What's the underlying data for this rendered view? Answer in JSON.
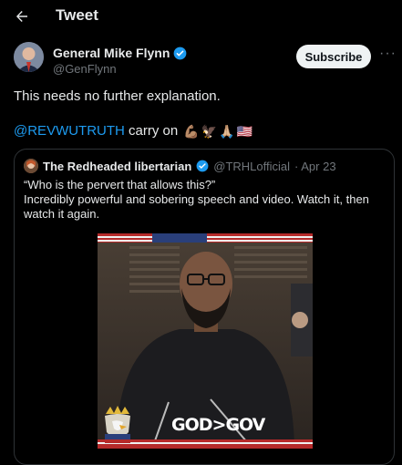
{
  "header": {
    "title": "Tweet",
    "back_icon": "arrow-left-icon"
  },
  "author": {
    "name": "General Mike Flynn",
    "handle": "@GenFlynn",
    "verified": true,
    "subscribe_label": "Subscribe",
    "more_label": "···"
  },
  "tweet": {
    "text": "This needs no further explanation.",
    "mention": "@REVWUTRUTH",
    "after_mention": " carry on ",
    "emojis": [
      "💪🏽",
      "🦅",
      "🙏🏼",
      "🇺🇸"
    ]
  },
  "quote": {
    "name": "The Redheaded libertarian",
    "handle": "@TRHLofficial",
    "date": "· Apr 23",
    "text_line1": "“Who is the pervert that allows this?”",
    "text_line2": "Incredibly powerful and sobering speech and video. Watch it, then watch it again.",
    "video_caption": "GOD>GOV"
  },
  "colors": {
    "accent": "#1d9bf0",
    "bg": "#000000",
    "muted": "#71767b",
    "border": "#2f3336"
  }
}
